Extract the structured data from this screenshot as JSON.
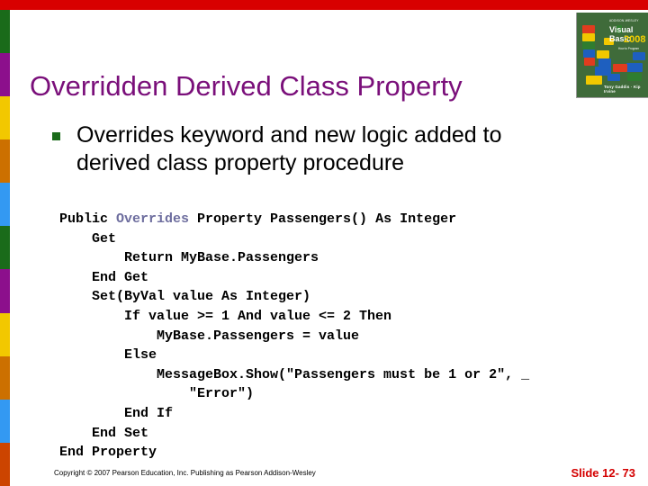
{
  "slide": {
    "title": "Overridden Derived Class Property",
    "title_color": "#7a0f7a",
    "background": "#ffffff"
  },
  "decor": {
    "top_bar_color": "#d80000",
    "left_strip_colors": [
      "#1a6b1a",
      "#8c0f8c",
      "#f2c800",
      "#cc7000",
      "#3399f2",
      "#1a6b1a",
      "#8c0f8c",
      "#f2c800",
      "#cc7000",
      "#3399f2",
      "#cc4400"
    ],
    "bullet_marker_color": "#1a6b1a"
  },
  "bullet": {
    "text": "Overrides keyword and new logic added to derived class property procedure"
  },
  "code": {
    "highlight_keyword": "Overrides",
    "highlight_color": "#6d6d9e",
    "lines": [
      "Public ",
      " Property Passengers() As Integer",
      "    Get",
      "        Return MyBase.Passengers",
      "    End Get",
      "    Set(ByVal value As Integer)",
      "        If value >= 1 And value <= 2 Then",
      "            MyBase.Passengers = value",
      "        Else",
      "            MessageBox.Show(\"Passengers must be 1 or 2\", _",
      "                \"Error\")",
      "        End If",
      "    End Set",
      "End Property"
    ],
    "line_01_prefix": "Public ",
    "line_01_suffix": " Property Passengers() As Integer",
    "line_02": "    Get",
    "line_03": "        Return MyBase.Passengers",
    "line_04": "    End Get",
    "line_05": "    Set(ByVal value As Integer)",
    "line_06": "        If value >= 1 And value <= 2 Then",
    "line_07": "            MyBase.Passengers = value",
    "line_08": "        Else",
    "line_09": "            MessageBox.Show(\"Passengers must be 1 or 2\", _",
    "line_10": "                \"Error\")",
    "line_11": "        End If",
    "line_12": "    End Set",
    "line_13": "End Property"
  },
  "footer": {
    "copyright": "Copyright © 2007 Pearson Education, Inc. Publishing as Pearson Addison-Wesley",
    "slide_number": "Slide 12- 73",
    "slide_number_color": "#d40000"
  },
  "book_cover": {
    "imprint": "ADDISON-WESLEY",
    "title": "Visual Basic",
    "year": "2008",
    "subtitle": "How to Program",
    "authors": "Tony Gaddis  ·  Kip Irvine"
  }
}
